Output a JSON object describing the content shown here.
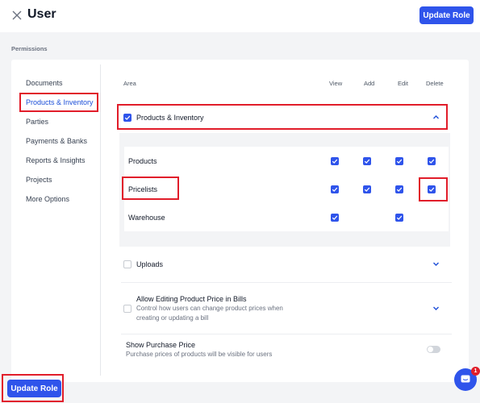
{
  "header": {
    "title": "User",
    "update_label": "Update Role"
  },
  "section_label": "Permissions",
  "sidebar": {
    "items": [
      {
        "label": "Documents"
      },
      {
        "label": "Products & Inventory"
      },
      {
        "label": "Parties"
      },
      {
        "label": "Payments & Banks"
      },
      {
        "label": "Reports & Insights"
      },
      {
        "label": "Projects"
      },
      {
        "label": "More Options"
      }
    ],
    "active": "Products & Inventory"
  },
  "table": {
    "columns": {
      "area": "Area",
      "view": "View",
      "add": "Add",
      "edit": "Edit",
      "delete": "Delete"
    },
    "group": {
      "label": "Products & Inventory",
      "checked": true,
      "expanded": true
    },
    "rows": [
      {
        "label": "Products",
        "view": true,
        "add": true,
        "edit": true,
        "delete": true
      },
      {
        "label": "Pricelists",
        "view": true,
        "add": true,
        "edit": true,
        "delete": true
      },
      {
        "label": "Warehouse",
        "view": true,
        "add": null,
        "edit": true,
        "delete": null
      }
    ]
  },
  "uploads": {
    "label": "Uploads",
    "checked": false
  },
  "allow_editing": {
    "label": "Allow Editing Product Price in Bills",
    "desc_line1": "Control how users can change product prices when",
    "desc_line2": "creating or updating a bill",
    "checked": false
  },
  "show_purchase": {
    "label": "Show Purchase Price",
    "desc": "Purchase prices of products will be visible for users",
    "enabled": false
  },
  "footer": {
    "update_label": "Update Role"
  },
  "chat": {
    "badge": "1"
  },
  "colors": {
    "primary": "#2f54eb",
    "highlight": "#e11d2a"
  }
}
